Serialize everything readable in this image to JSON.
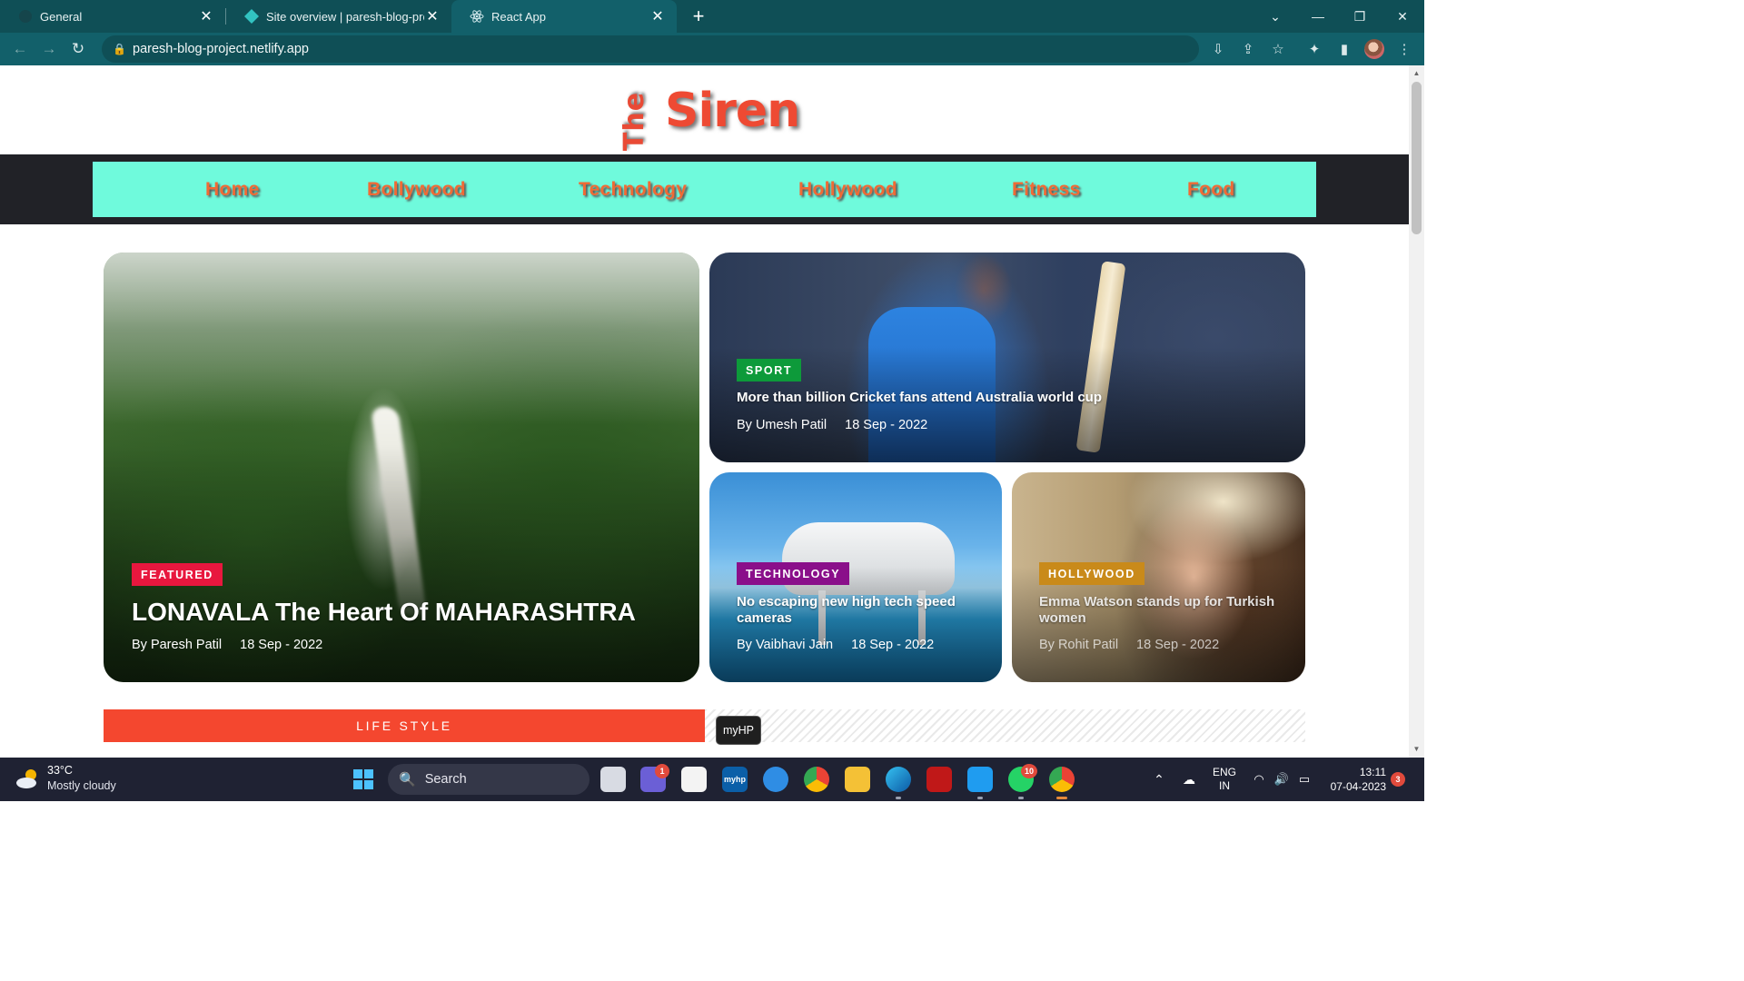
{
  "browser": {
    "tabs": [
      {
        "title": "General",
        "active": false
      },
      {
        "title": "Site overview | paresh-blog-proje",
        "active": false
      },
      {
        "title": "React App",
        "active": true
      }
    ],
    "url": "paresh-blog-project.netlify.app"
  },
  "site": {
    "logo_the": "The",
    "logo_siren": "Siren",
    "nav": [
      "Home",
      "Bollywood",
      "Technology",
      "Hollywood",
      "Fitness",
      "Food"
    ]
  },
  "cards": {
    "featured": {
      "badge": "FEATURED",
      "badge_color": "#e8173e",
      "title": "LONAVALA The Heart Of MAHARASHTRA",
      "author": "By Paresh Patil",
      "date": "18 Sep - 2022"
    },
    "sport": {
      "badge": "SPORT",
      "badge_color": "#0d9a3a",
      "title": "More than billion Cricket fans attend Australia world cup",
      "author": "By Umesh Patil",
      "date": "18 Sep - 2022"
    },
    "technology": {
      "badge": "TECHNOLOGY",
      "badge_color": "#8a0f8a",
      "title": "No escaping new high tech speed cameras",
      "author": "By Vaibhavi Jain",
      "date": "18 Sep - 2022"
    },
    "hollywood": {
      "badge": "HOLLYWOOD",
      "badge_color": "#c98a1a",
      "title": "Emma Watson stands up for Turkish women",
      "author": "By Rohit Patil",
      "date": "18 Sep - 2022"
    }
  },
  "section": {
    "lifestyle": "LIFE STYLE"
  },
  "tooltip": "myHP",
  "taskbar": {
    "temp": "33°C",
    "weather": "Mostly cloudy",
    "search": "Search",
    "lang": "ENG",
    "region": "IN",
    "time": "13:11",
    "date": "07-04-2023",
    "teams_badge": "1",
    "whatsapp_badge": "10",
    "notify_count": "3"
  }
}
